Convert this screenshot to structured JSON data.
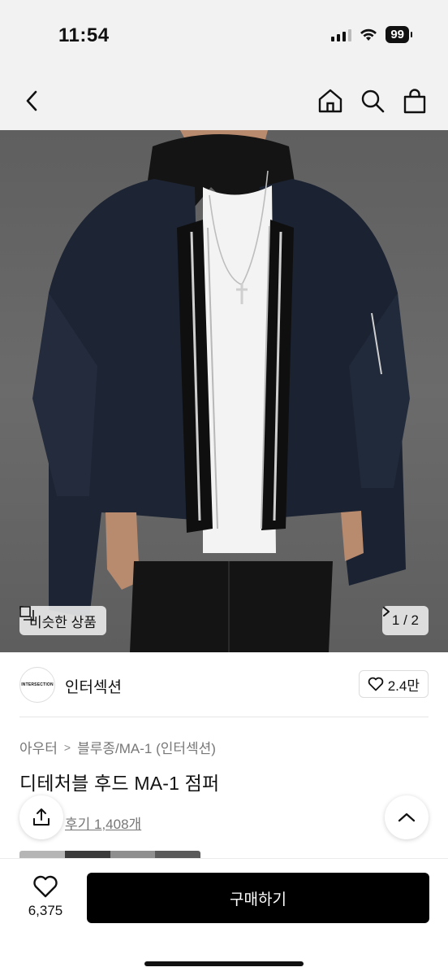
{
  "status_bar": {
    "time": "11:54",
    "battery": "99"
  },
  "hero": {
    "similar_label": "비슷한 상품",
    "page_indicator": "1 / 2"
  },
  "brand": {
    "logo_text": "INTERSECTION",
    "name": "인터섹션",
    "likes": "2.4만"
  },
  "product": {
    "breadcrumb": [
      "아우터",
      "블루종/MA-1 (인터섹션)"
    ],
    "title": "디테처블 후드 MA-1 점퍼",
    "reviews": "후기 1,408개"
  },
  "bottom_bar": {
    "wish_count": "6,375",
    "buy_label": "구매하기"
  },
  "icons": [
    "back-icon",
    "home-icon",
    "search-icon",
    "bag-icon",
    "similar-icon",
    "chevron-right-icon",
    "heart-icon",
    "share-icon",
    "chevron-up-icon"
  ]
}
